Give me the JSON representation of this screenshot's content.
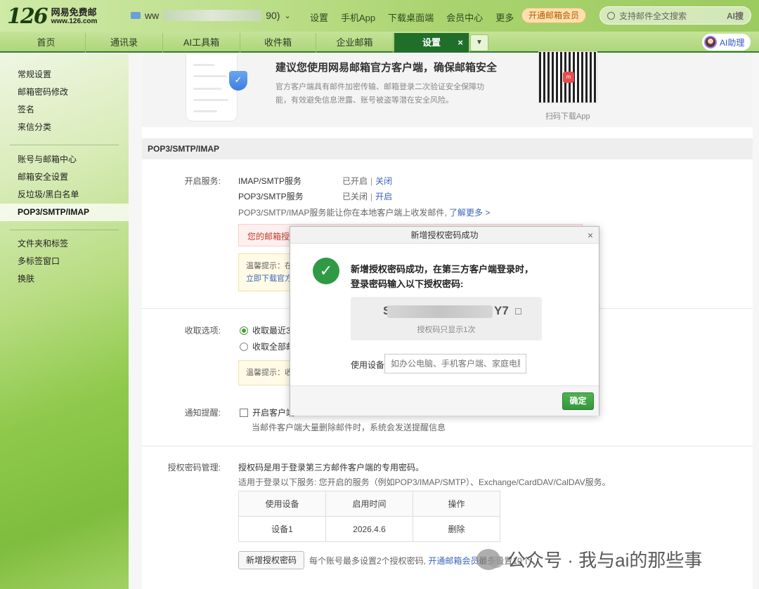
{
  "header": {
    "logo_number": "126",
    "logo_name": "网易免费邮",
    "logo_url": "www.126.com",
    "account_prefix": "ww",
    "account_suffix": "90)",
    "nav": [
      "设置",
      "手机App",
      "下载桌面端",
      "会员中心",
      "更多"
    ],
    "vip_label": "开通邮箱会员",
    "search_placeholder": "支持邮件全文搜索",
    "ai_search": "AI搜"
  },
  "tabs": [
    {
      "label": "首页"
    },
    {
      "label": "通讯录"
    },
    {
      "label": "AI工具箱"
    },
    {
      "label": "收件箱"
    },
    {
      "label": "企业邮箱"
    },
    {
      "label": "设置",
      "active": true
    }
  ],
  "ai_assistant": "AI助理",
  "sidebar": {
    "group1": [
      "常规设置",
      "邮箱密码修改",
      "签名",
      "来信分类"
    ],
    "group2": [
      "账号与邮箱中心",
      "邮箱安全设置",
      "反垃圾/黑白名单",
      "POP3/SMTP/IMAP"
    ],
    "group3": [
      "文件夹和标签",
      "多标签窗口",
      "换肤"
    ],
    "active": "POP3/SMTP/IMAP"
  },
  "banner": {
    "title": "建议您使用网易邮箱官方客户端，确保邮箱安全",
    "desc": "官方客户端具有邮件加密传输、邮箱登录二次验证安全保障功能，有效避免信息泄露、账号被盗等潜在安全风险。",
    "qr_label": "扫码下载App"
  },
  "section_title": "POP3/SMTP/IMAP",
  "services": {
    "label": "开启服务:",
    "imap": {
      "name": "IMAP/SMTP服务",
      "status": "已开启",
      "action": "关闭"
    },
    "pop3": {
      "name": "POP3/SMTP服务",
      "status": "已关闭",
      "action": "开启"
    },
    "desc": "POP3/SMTP/IMAP服务能让你在本地客户端上收发邮件,",
    "learn_more": "了解更多 >",
    "warning": "您的邮箱授",
    "tip_line1": "温馨提示：在",
    "tip_link": "立即下载官方"
  },
  "receive": {
    "label": "收取选项:",
    "option1": "收取最近3",
    "option2": "收取全部邮",
    "tip": "温馨提示：收"
  },
  "notify": {
    "label": "通知提醒:",
    "option": "开启客户端",
    "desc": "当邮件客户端大量删除邮件时，系统会发送提醒信息"
  },
  "auth": {
    "label": "授权密码管理:",
    "desc1": "授权码是用于登录第三方邮件客户端的专用密码。",
    "desc2": "适用于登录以下服务: 您开启的服务（例如POP3/IMAP/SMTP）、Exchange/CardDAV/CalDAV服务。",
    "columns": [
      "使用设备",
      "启用时间",
      "操作"
    ],
    "rows": [
      {
        "device": "设备1",
        "time": "2026.4.6",
        "action": "删除"
      }
    ],
    "add_button": "新增授权密码",
    "limit_note": "每个账号最多设置2个授权密码,",
    "limit_link": "开通邮箱会员",
    "limit_tail": "最多设置10个"
  },
  "modal": {
    "title": "新增授权密码成功",
    "message": "新增授权密码成功，在第三方客户端登录时，登录密码输入以下授权密码:",
    "code_start": "S",
    "code_end": "Y7",
    "code_note": "授权码只显示1次",
    "device_label": "使用设备",
    "device_placeholder": "如办公电脑、手机客户端、家庭电脑等",
    "ok": "确定"
  },
  "watermark": "公众号 · 我与ai的那些事"
}
